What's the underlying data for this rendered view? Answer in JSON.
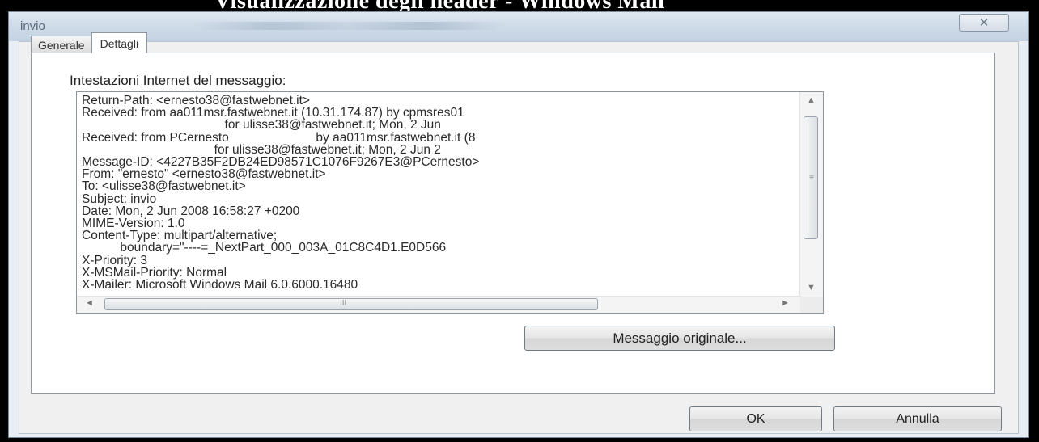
{
  "caption": "Visualizzazione degli header - Windows Mail",
  "window": {
    "title": "invio",
    "close_glyph": "✕"
  },
  "tabs": [
    {
      "label": "Generale",
      "active": false
    },
    {
      "label": "Dettagli",
      "active": true
    }
  ],
  "section_label": "Intestazioni Internet del messaggio:",
  "headers_lines": [
    "Return-Path: <ernesto38@fastwebnet.it>",
    "Received: from aa011msr.fastwebnet.it (10.31.174.87) by cpmsres01",
    "                                         for ulisse38@fastwebnet.it; Mon, 2 Jun",
    "Received: from PCernesto                         by aa011msr.fastwebnet.it (8",
    "                                      for ulisse38@fastwebnet.it; Mon, 2 Jun 2",
    "Message-ID: <4227B35F2DB24ED98571C1076F9267E3@PCernesto>",
    "From: \"ernesto\" <ernesto38@fastwebnet.it>",
    "To: <ulisse38@fastwebnet.it>",
    "Subject: invio",
    "Date: Mon, 2 Jun 2008 16:58:27 +0200",
    "MIME-Version: 1.0",
    "Content-Type: multipart/alternative;",
    "           boundary=\"----=_NextPart_000_003A_01C8C4D1.E0D566",
    "X-Priority: 3",
    "X-MSMail-Priority: Normal",
    "X-Mailer: Microsoft Windows Mail 6.0.6000.16480"
  ],
  "buttons": {
    "original_message": "Messaggio originale...",
    "ok": "OK",
    "cancel": "Annulla"
  },
  "scroll_glyphs": {
    "up": "▲",
    "down": "▼",
    "left": "◄",
    "right": "►",
    "grip_v": "≡",
    "grip_h": "III"
  },
  "colors": {
    "window_bg": "#e9eef4",
    "panel_bg": "#ffffff",
    "text": "#2a2a2a"
  }
}
